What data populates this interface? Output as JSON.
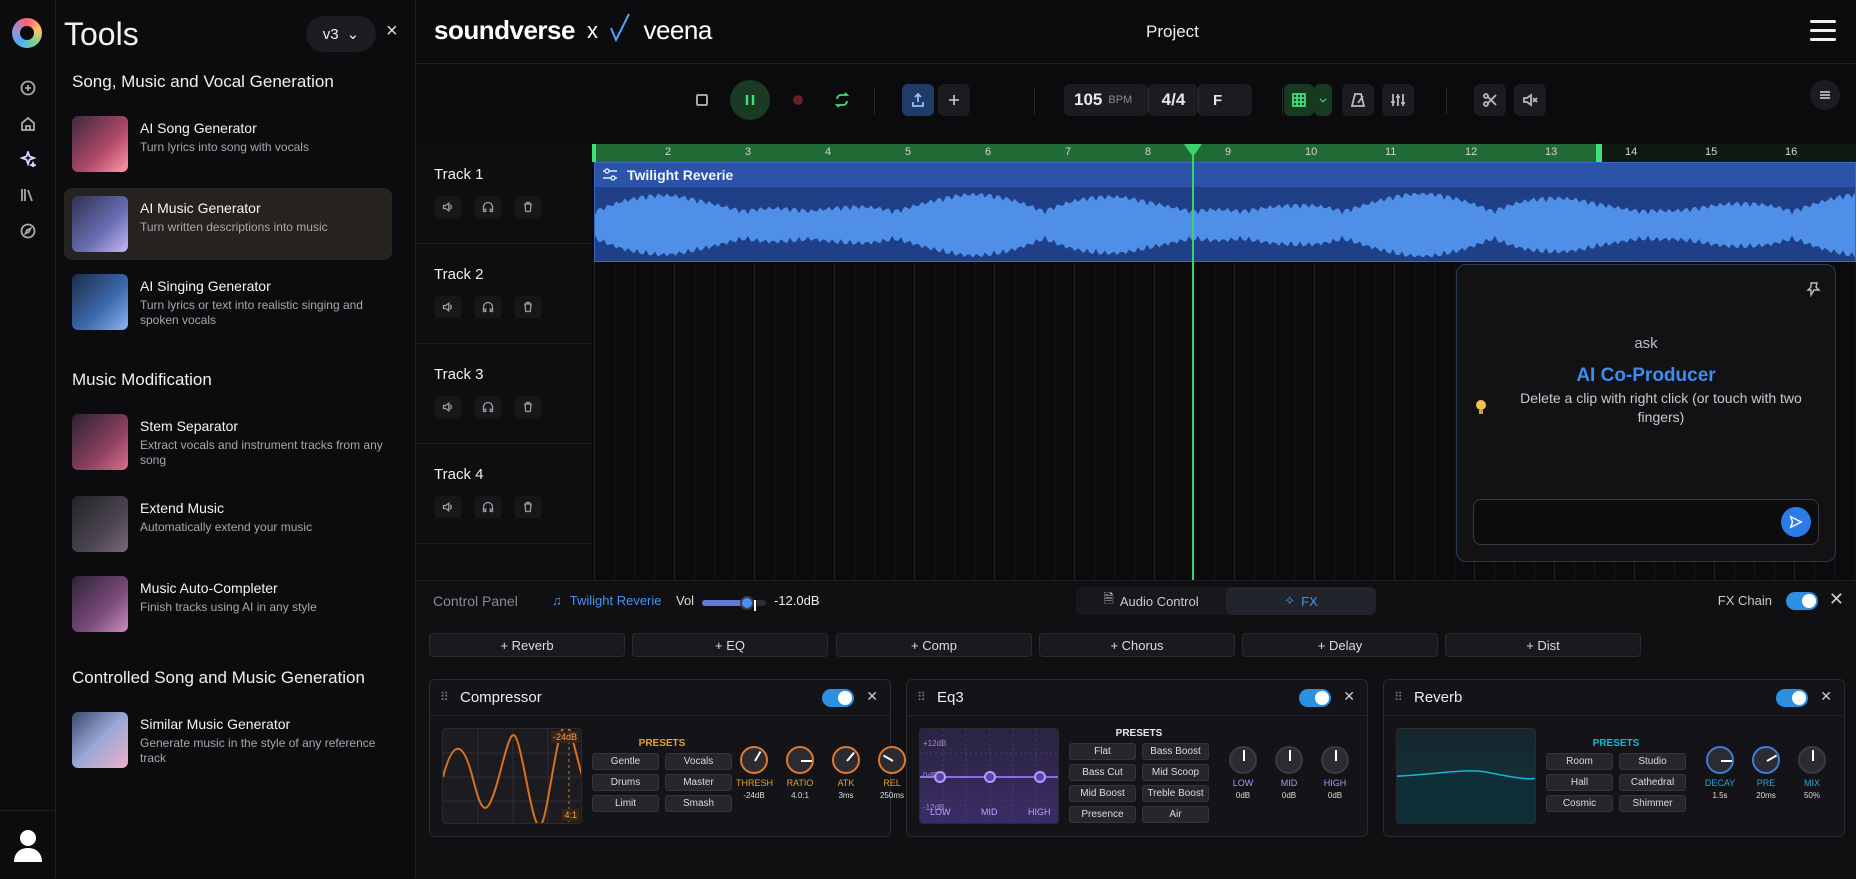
{
  "tools_panel": {
    "title": "Tools",
    "version": "v3",
    "close": "×",
    "sections": [
      {
        "title": "Song, Music and Vocal Generation"
      },
      {
        "title": "Music Modification"
      },
      {
        "title": "Controlled Song and Music Generation"
      }
    ],
    "items": [
      {
        "title": "AI Song Generator",
        "desc": "Turn lyrics into song with vocals"
      },
      {
        "title": "AI Music Generator",
        "desc": "Turn written descriptions into music"
      },
      {
        "title": "AI Singing Generator",
        "desc": "Turn lyrics or text into realistic singing and spoken vocals"
      },
      {
        "title": "Stem Separator",
        "desc": "Extract vocals and instrument tracks from any song"
      },
      {
        "title": "Extend Music",
        "desc": "Automatically extend your music"
      },
      {
        "title": "Music Auto-Completer",
        "desc": "Finish tracks using AI in any style"
      },
      {
        "title": "Similar Music Generator",
        "desc": "Generate music in the style of any reference track"
      }
    ]
  },
  "header": {
    "brand": "soundverse",
    "brand_x": "x",
    "brand_partner": "veena",
    "project": "Project"
  },
  "transport": {
    "bpm": "105",
    "bpm_unit": "BPM",
    "time_signature": "4/4",
    "key": "F"
  },
  "ruler": {
    "bars": [
      "2",
      "3",
      "4",
      "5",
      "6",
      "7",
      "8",
      "9",
      "10",
      "11",
      "12",
      "13",
      "14",
      "15",
      "16"
    ]
  },
  "tracks": [
    {
      "name": "Track 1"
    },
    {
      "name": "Track 2"
    },
    {
      "name": "Track 3"
    },
    {
      "name": "Track 4"
    }
  ],
  "clip": {
    "name": "Twilight Reverie"
  },
  "co_producer": {
    "ask": "ask",
    "title": "AI Co-Producer",
    "tip": "Delete a clip with right click (or touch with two fingers)",
    "input_value": ""
  },
  "control_panel": {
    "label": "Control Panel",
    "clip_name": "Twilight Reverie",
    "vol_label": "Vol",
    "vol_db": "-12.0dB",
    "vol_level": 0.7,
    "tabs": [
      {
        "label": "Audio Control"
      },
      {
        "label": "FX"
      }
    ],
    "fx_chain_label": "FX Chain",
    "add_buttons": [
      "+ Reverb",
      "+ EQ",
      "+ Comp",
      "+ Chorus",
      "+ Delay",
      "+ Dist"
    ]
  },
  "fx_units": [
    {
      "name": "Compressor",
      "presets_label": "PRESETS",
      "presets": [
        "Gentle",
        "Vocals",
        "Drums",
        "Master",
        "Limit",
        "Smash"
      ],
      "vis_labels": [
        "-24dB",
        "4:1"
      ],
      "knobs": [
        {
          "label": "THRESH",
          "value": "-24dB"
        },
        {
          "label": "RATIO",
          "value": "4.0:1"
        },
        {
          "label": "ATK",
          "value": "3ms"
        },
        {
          "label": "REL",
          "value": "250ms"
        }
      ]
    },
    {
      "name": "Eq3",
      "presets_label": "PRESETS",
      "presets": [
        "Flat",
        "Bass Boost",
        "Bass Cut",
        "Mid Scoop",
        "Mid Boost",
        "Treble Boost",
        "Presence",
        "Air"
      ],
      "vis_labels": [
        "+12dB",
        "0dB",
        "-12dB",
        "LOW",
        "MID",
        "HIGH"
      ],
      "knobs": [
        {
          "label": "LOW",
          "value": "0dB"
        },
        {
          "label": "MID",
          "value": "0dB"
        },
        {
          "label": "HIGH",
          "value": "0dB"
        }
      ]
    },
    {
      "name": "Reverb",
      "presets_label": "PRESETS",
      "presets": [
        "Room",
        "Studio",
        "Hall",
        "Cathedral",
        "Cosmic",
        "Shimmer"
      ],
      "knobs": [
        {
          "label": "DECAY",
          "value": "1.5s"
        },
        {
          "label": "PRE",
          "value": "20ms"
        },
        {
          "label": "MIX",
          "value": "50%"
        }
      ]
    }
  ],
  "colors": {
    "accent_blue": "#2d7be8",
    "playhead_green": "#39d36b",
    "clip_blue": "#1f3f86",
    "comp_accent": "#e2a035",
    "eq_accent": "#8a6cf0",
    "reverb_accent": "#16b8d8"
  }
}
